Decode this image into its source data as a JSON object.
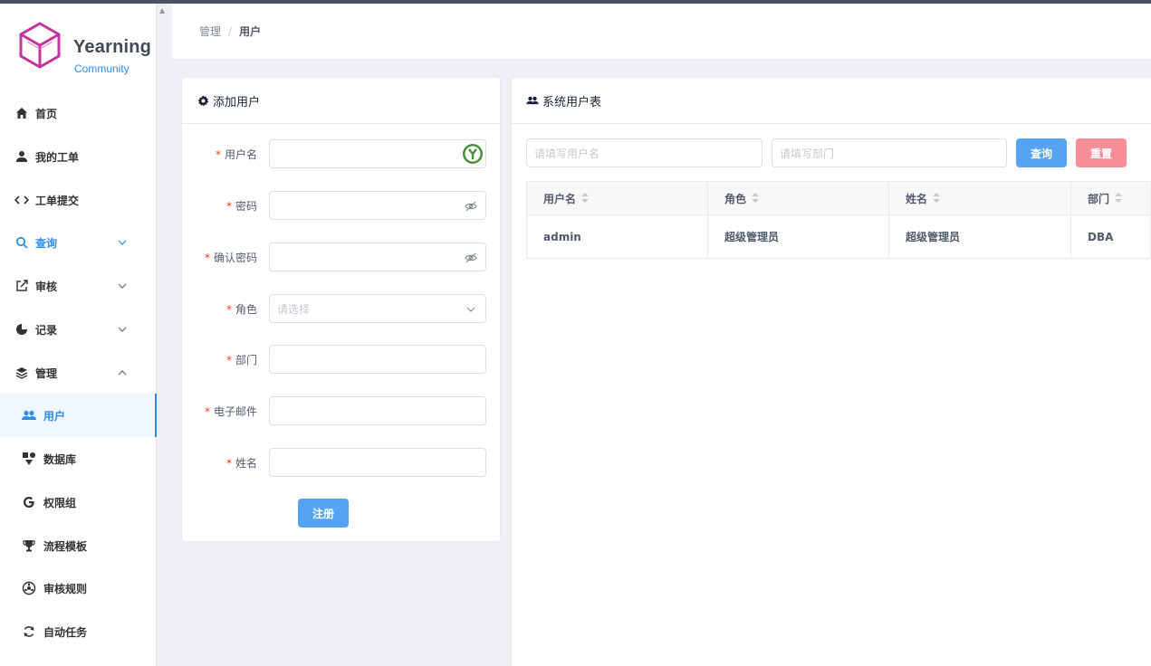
{
  "app": {
    "name": "Yearning",
    "edition": "Community"
  },
  "breadcrumb": {
    "parent": "管理",
    "separator": "/",
    "current": "用户"
  },
  "sidebar": {
    "items": [
      {
        "label": "首页",
        "icon": "home-icon"
      },
      {
        "label": "我的工单",
        "icon": "person-icon"
      },
      {
        "label": "工单提交",
        "icon": "code-icon"
      },
      {
        "label": "查询",
        "icon": "search-icon",
        "expandable": true,
        "highlighted": true
      },
      {
        "label": "审核",
        "icon": "edit-icon",
        "expandable": true
      },
      {
        "label": "记录",
        "icon": "pie-chart-icon",
        "expandable": true
      },
      {
        "label": "管理",
        "icon": "layers-icon",
        "expandable": true,
        "expanded": true
      }
    ],
    "sub_items": [
      {
        "label": "用户",
        "icon": "people-icon",
        "selected": true
      },
      {
        "label": "数据库",
        "icon": "database-icon"
      },
      {
        "label": "权限组",
        "icon": "google-icon"
      },
      {
        "label": "流程模板",
        "icon": "trophy-icon"
      },
      {
        "label": "审核规则",
        "icon": "rules-icon"
      },
      {
        "label": "自动任务",
        "icon": "sync-icon"
      }
    ]
  },
  "add_user": {
    "title": "添加用户",
    "fields": [
      {
        "label": "用户名",
        "required": true,
        "value": "",
        "placeholder": ""
      },
      {
        "label": "密码",
        "required": true,
        "value": "",
        "placeholder": ""
      },
      {
        "label": "确认密码",
        "required": true,
        "value": "",
        "placeholder": ""
      },
      {
        "label": "角色",
        "required": true,
        "value": "",
        "placeholder": "请选择"
      },
      {
        "label": "部门",
        "required": true,
        "value": "",
        "placeholder": ""
      },
      {
        "label": "电子邮件",
        "required": true,
        "value": "",
        "placeholder": ""
      },
      {
        "label": "姓名",
        "required": true,
        "value": "",
        "placeholder": ""
      }
    ],
    "submit_label": "注册"
  },
  "user_table": {
    "title": "系统用户表",
    "search_username_placeholder": "请填写用户名",
    "search_dept_placeholder": "请填写部门",
    "query_label": "查询",
    "reset_label": "重置",
    "columns": [
      "用户名",
      "角色",
      "姓名",
      "部门"
    ],
    "rows": [
      [
        "admin",
        "超级管理员",
        "超级管理员",
        "DBA"
      ]
    ]
  },
  "colors": {
    "primary": "#57a3f3",
    "danger": "#f78e97",
    "accent": "#2d8cf0",
    "required": "#ed4014"
  }
}
